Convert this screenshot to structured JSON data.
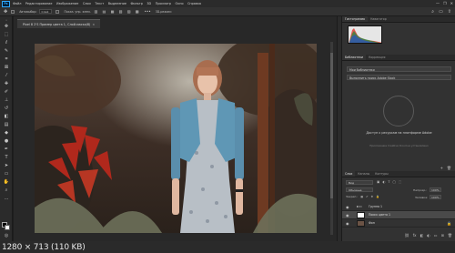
{
  "app": {
    "logo": "Ps",
    "menu": [
      "Файл",
      "Редактирование",
      "Изображение",
      "Слои",
      "Текст",
      "Выделение",
      "Фильтр",
      "3D",
      "Просмотр",
      "Окно",
      "Справка"
    ],
    "window_controls": [
      "—",
      "❐",
      "✕"
    ]
  },
  "options": {
    "tool_icon": "move-tool-icon",
    "autoselect_label": "Автовыбор:",
    "autoselect_value": "Слой",
    "transform_label": "Показ. упр. элем.",
    "mode_label": "3D-режим:"
  },
  "document": {
    "tab_title": "Pixel 8 2'S Пример цвета 1, Слой-маска/8)",
    "close": "×"
  },
  "panels": {
    "top_tabs": [
      "Гистограмма",
      "Навигатор"
    ],
    "nav_tabs": [
      "Библиотеки",
      "Коррекция"
    ],
    "library_dropdown": "Мои библиотеки",
    "library_search": "Выполнить поиск Adobe Stock",
    "library_message": "Доступ к ресурсам на платформе Adobe",
    "library_sub": "Приложение Creative Cloud не установлено",
    "layer_tabs": [
      "Слои",
      "Каналы",
      "Контуры"
    ],
    "layer_search": "Вид",
    "blend_mode": "Обычные",
    "opacity_label": "Непрозр.:",
    "opacity_value": "100%",
    "lock_label": "Закреп.:",
    "fill_label": "Заливка:",
    "fill_value": "100%",
    "layers": [
      {
        "name": "Группа 1",
        "type": "group"
      },
      {
        "name": "Поиск цвета 1",
        "type": "adjustment",
        "selected": true
      },
      {
        "name": "Фон",
        "type": "image"
      }
    ]
  },
  "status": {
    "dimensions": "1280 × 713 (110 KB)",
    "doc_info": "Док: 2.62M/5.24M"
  }
}
